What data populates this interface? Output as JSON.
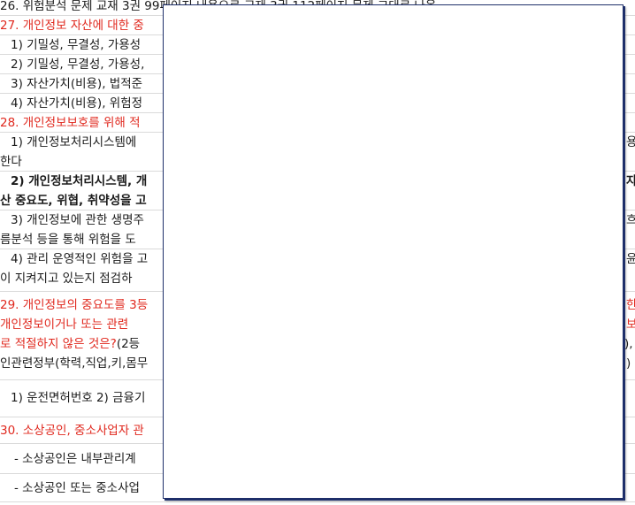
{
  "doc": {
    "q26": "26. 위험분석 문제 교재 3권 99페이지 내용으로 교재 3권 112페이지 문제 그대로 나옴",
    "q27_title": "27. 개인정보 자산에 대한 중",
    "q27_o1": "1) 기밀성, 무결성, 가용성",
    "q27_o2": "2) 기밀성, 무결성, 가용성,",
    "q27_o3": "3) 자산가치(비용), 법적준",
    "q27_o4": "4) 자산가치(비용), 위험정",
    "q28_title": "28. 개인정보보호를 위해 적",
    "q28_o1a": "1) 개인정보처리시스템에",
    "q28_o1a_right": "용",
    "q28_o1b": "한다",
    "q28_o2a": "2) 개인정보처리시스템, 개",
    "q28_o2a_right": "자",
    "q28_o2b": "산 중요도, 위협, 취약성을 고",
    "q28_o3a": "3) 개인정보에 관한 생명주",
    "q28_o3a_right": "흐",
    "q28_o3b": "름분석 등을 통해 위험을 도",
    "q28_o4a": "4) 관리 운영적인 위험을 고",
    "q28_o4a_right": "윤",
    "q28_o4b": "이 지켜지고 있는지 점검하",
    "q29_l1": "29. 개인정보의 중요도를 3등",
    "q29_l1_right": "한",
    "q29_l2": "개인정보이거나 또는 관련",
    "q29_l2_right": "보",
    "q29_l3_red": "로 적절하지 않은 것은?",
    "q29_l3_black": "(2등",
    "q29_l3_right": "),",
    "q29_l4": "인관련정부(학력,직업,키,몸무",
    "q29_l4_right": ")",
    "q29_opts": "1) 운전면허번호   2) 금융기",
    "q30_title": "30. 소상공인, 중소사업자 관",
    "q30_b1": "- 소상공인은 내부관리계",
    "q30_b2": "- 소상공인 또는 중소사업"
  }
}
